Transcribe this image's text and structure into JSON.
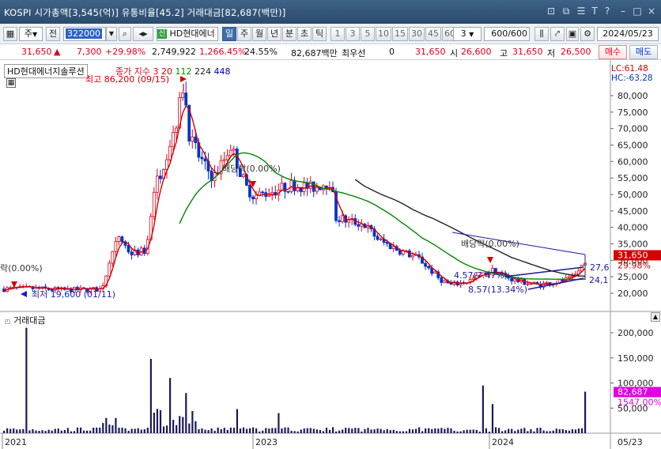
{
  "window": {
    "title": "KOSPI 시가총액[3,545(억)] 유통비율[45.2] 거래대금[82,687(백만)]",
    "icons": [
      "link-icon",
      "restore-icon",
      "list-icon",
      "text-icon",
      "help-icon",
      "minimize-icon",
      "maximize-icon",
      "close-icon"
    ],
    "icon_glyphs": [
      "⊡",
      "⧉",
      "☰",
      "T",
      "?",
      "–",
      "□",
      "×"
    ]
  },
  "toolbar": {
    "period_select": "주",
    "all_label": "전",
    "code_value": "322000",
    "stock_name": "HD현대에너",
    "period_buttons": [
      "일",
      "주",
      "월",
      "년",
      "분",
      "초",
      "틱"
    ],
    "active_period": "일",
    "interval_buttons": [
      "1",
      "3",
      "5",
      "10",
      "15",
      "30",
      "45",
      "60"
    ],
    "interval_value": "3",
    "count_value": "600",
    "count_total": "/600",
    "date_value": "2024/05/23"
  },
  "quote": {
    "price": "31,650",
    "arrow": "▲",
    "change": "7,300",
    "change_pct": "+29.98%",
    "volume": "2,749,922",
    "volume_ratio": "1,266.45%",
    "turnover": "24.55%",
    "amount": "82,687백만",
    "pref_label": "최우선",
    "pref_value": "0",
    "ask": "31,650",
    "open_label": "시",
    "open_value": "26,600",
    "high_label": "고",
    "high_value": "31,650",
    "low_label": "저",
    "low_value": "26,500",
    "buy_label": "매수",
    "sell_label": "매도"
  },
  "price_panel": {
    "stock_label": "HD현대에너지솔루션",
    "ma_title": "종가 지수 3",
    "ma_periods": [
      {
        "label": "20",
        "color": "#d40000"
      },
      {
        "label": "112",
        "color": "#008800"
      },
      {
        "label": "224",
        "color": "#222222"
      },
      {
        "label": "448",
        "color": "#0000aa"
      }
    ],
    "lc_label": "LC:61.48",
    "hc_label": "HC:-63.28",
    "y_ticks": [
      "80,000",
      "75,000",
      "70,000",
      "65,000",
      "60,000",
      "55,000",
      "50,000",
      "45,000",
      "40,000",
      "35,000",
      "30,000",
      "25,000",
      "20,000"
    ],
    "current_price_badge": "31,650",
    "current_pct": "29.98%",
    "annotations": {
      "high": "최고 86,200 (09/15)",
      "low": "최저 19,600 (01/11)",
      "dividend_mid": "배당락(0.00%)",
      "dividend_left": "락(0.00%)",
      "dividend_right": "배당락(0.00%)",
      "trend_top": "4.57(7.47%)",
      "trend_bottom": "8.57(13.34%)",
      "level_upper": "27,6",
      "level_lower": "24,1"
    },
    "colors": {
      "ma20": "#d40000",
      "ma112": "#008800",
      "ma224": "#222222",
      "candle_up": "#e0001a",
      "candle_down": "#0033cc",
      "trend": "#1a1aa0"
    }
  },
  "volume_panel": {
    "label": "거래대금",
    "y_ticks": [
      "200,000",
      "150,000",
      "100,000",
      "50,000"
    ],
    "current_badge": "82,687",
    "current_pct": "1547.00%"
  },
  "x_axis": {
    "labels": [
      "2021",
      "2023",
      "2024"
    ],
    "right_label": "05/23"
  }
}
